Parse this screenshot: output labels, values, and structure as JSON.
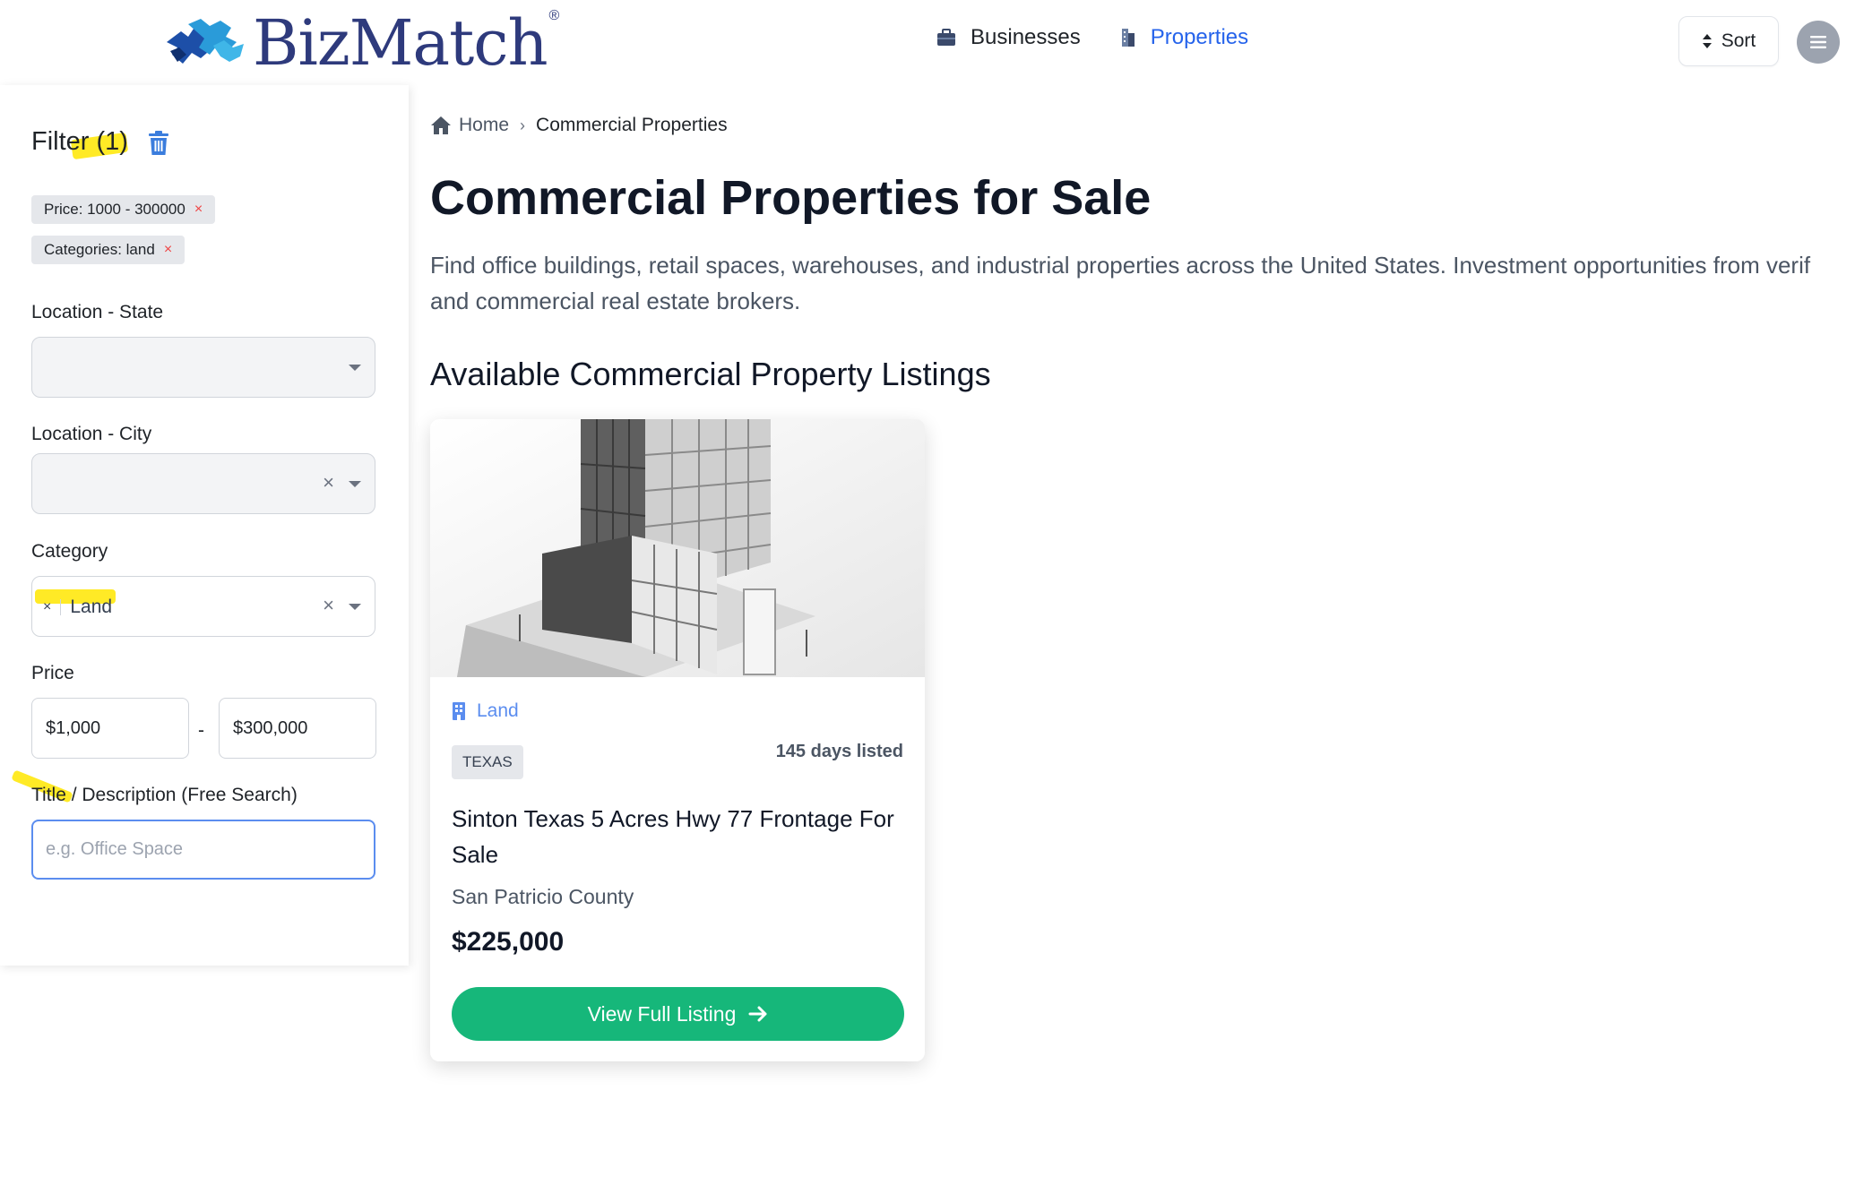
{
  "header": {
    "logo_text": "BizMatch",
    "logo_reg": "®",
    "nav": [
      {
        "label": "Businesses",
        "active": false
      },
      {
        "label": "Properties",
        "active": true
      }
    ],
    "sort_label": "Sort"
  },
  "sidebar": {
    "filter_title": "Filter (1)",
    "chips": [
      {
        "label": "Price: 1000 - 300000",
        "remove": "×"
      },
      {
        "label": "Categories: land",
        "remove": "×"
      }
    ],
    "state_label": "Location - State",
    "city_label": "Location - City",
    "category_label": "Category",
    "category_selected": "Land",
    "category_tag_remove": "×",
    "clear_symbol": "×",
    "price_label": "Price",
    "price_min": "$1,000",
    "price_separator": "-",
    "price_max": "$300,000",
    "search_label": "Title / Description (Free Search)",
    "search_placeholder": "e.g. Office Space"
  },
  "main": {
    "breadcrumb": {
      "home": "Home",
      "separator": "›",
      "current": "Commercial Properties"
    },
    "title": "Commercial Properties for Sale",
    "description_line1": "Find office buildings, retail spaces, warehouses, and industrial properties across the United States. Investment opportunities from verif",
    "description_line2": "and commercial real estate brokers.",
    "section_title": "Available Commercial Property Listings",
    "listing": {
      "category": "Land",
      "state": "TEXAS",
      "days_listed": "145 days listed",
      "title": "Sinton Texas 5 Acres Hwy 77 Frontage For Sale",
      "county": "San Patricio County",
      "price": "$225,000",
      "button_label": "View Full Listing"
    }
  },
  "colors": {
    "brand": "#2e3a7c",
    "accent": "#2563eb",
    "button": "#16b77a",
    "highlight": "#ffe600",
    "chip_remove": "#ef4444"
  },
  "icons": [
    "puzzle-logo-icon",
    "briefcase-icon",
    "building-icon",
    "sort-arrows-icon",
    "menu-icon",
    "trash-icon",
    "home-icon",
    "chevron-right-icon",
    "arrow-right-icon"
  ]
}
